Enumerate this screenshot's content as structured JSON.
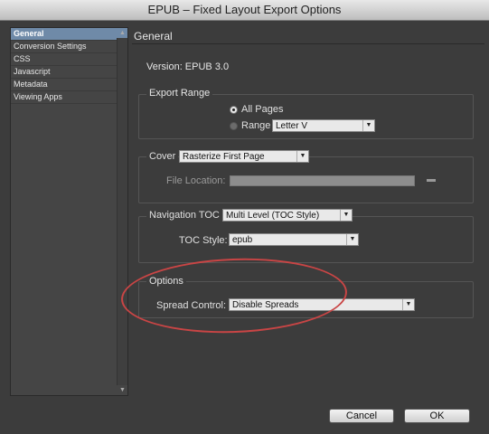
{
  "window": {
    "title": "EPUB – Fixed Layout Export Options"
  },
  "sidebar": {
    "items": [
      {
        "label": "General",
        "active": true
      },
      {
        "label": "Conversion Settings"
      },
      {
        "label": "CSS"
      },
      {
        "label": "Javascript"
      },
      {
        "label": "Metadata"
      },
      {
        "label": "Viewing Apps"
      }
    ]
  },
  "main": {
    "header": "General",
    "version": "Version: EPUB 3.0",
    "export_range": {
      "legend": "Export Range",
      "all_pages_label": "All Pages",
      "range_label": "Range",
      "range_value": "Letter V",
      "selected": "All Pages"
    },
    "cover": {
      "label": "Cover",
      "value": "Rasterize First Page",
      "file_location_label": "File Location:",
      "file_location_value": ""
    },
    "navigation": {
      "label": "Navigation TOC",
      "value": "Multi Level (TOC Style)",
      "toc_style_label": "TOC Style:",
      "toc_style_value": "epub"
    },
    "options": {
      "legend": "Options",
      "spread_control_label": "Spread Control:",
      "spread_control_value": "Disable Spreads"
    }
  },
  "footer": {
    "cancel_label": "Cancel",
    "ok_label": "OK"
  },
  "colors": {
    "highlight_ellipse": "#c94545",
    "sidebar_selection": "#6f8aa8"
  }
}
